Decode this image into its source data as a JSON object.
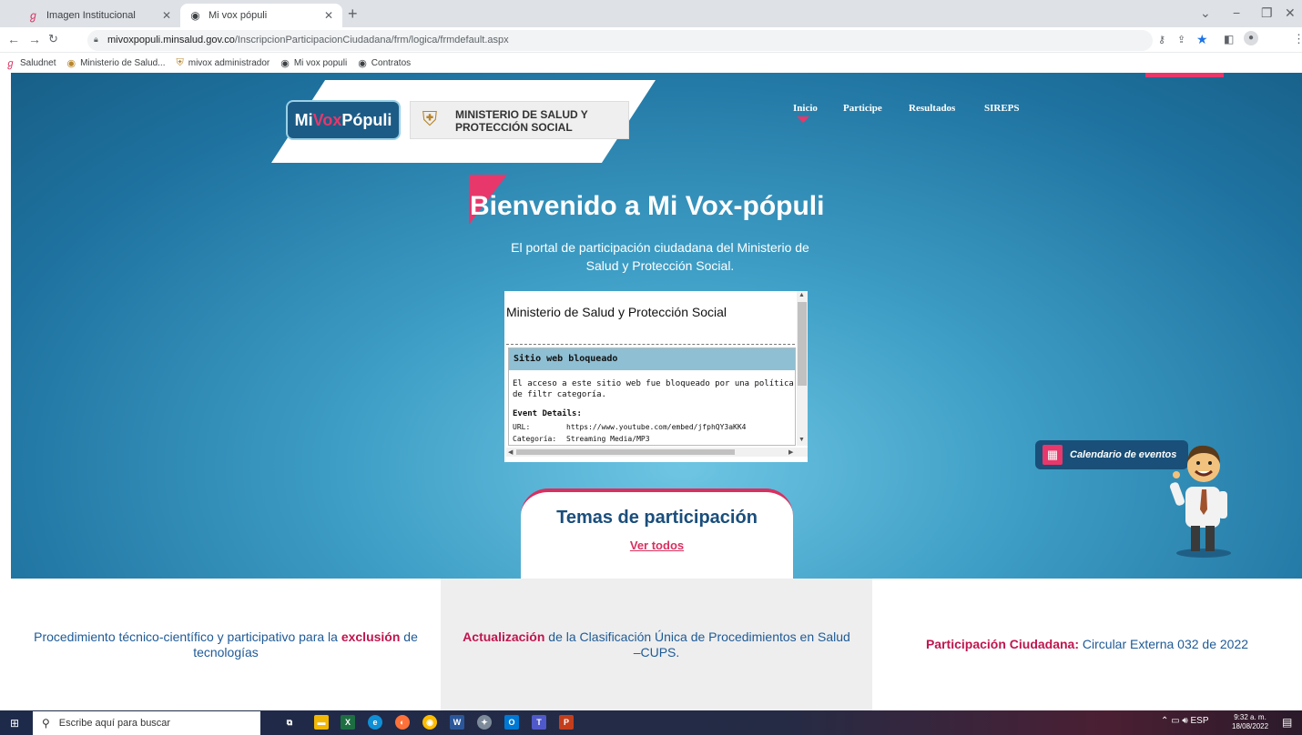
{
  "browser": {
    "tabs": [
      {
        "title": "Imagen Institucional",
        "icon": "saludnet-icon"
      },
      {
        "title": "Mi vox pópuli",
        "icon": "globe-icon"
      }
    ],
    "url_host": "mivoxpopuli.minsalud.gov.co",
    "url_path": "/InscripcionParticipacionCiudadana/frm/logica/frmdefault.aspx",
    "bookmarks": [
      "Saludnet",
      "Ministerio de Salud...",
      "mivox administrador",
      "Mi vox populi",
      "Contratos"
    ]
  },
  "header": {
    "logo_mi": "Mi",
    "logo_vox": "Vox",
    "logo_populi": "Pópuli",
    "ministry": "MINISTERIO DE SALUD Y PROTECCIÓN SOCIAL",
    "nav": [
      "Inicio",
      "Participe",
      "Resultados",
      "SIREPS"
    ]
  },
  "hero": {
    "title": "Bienvenido a Mi Vox-pópuli",
    "subtitle": "El portal de participación ciudadana del Ministerio de Salud y Protección Social."
  },
  "embed": {
    "org": "Ministerio de Salud y Protección Social",
    "blocked_title": "Sitio web bloqueado",
    "blocked_message": "El acceso a este sitio web fue bloqueado por una política de filtr categoría.",
    "event_details_label": "Event Details:",
    "url_label": "URL:",
    "url_value": "https://www.youtube.com/embed/jfphQY3aKK4",
    "category_label": "Categoría:",
    "category_value": "Streaming Media/MP3"
  },
  "temas": {
    "title": "Temas de participación",
    "link": "Ver todos"
  },
  "calendar": {
    "label": "Calendario de eventos"
  },
  "footer": {
    "col1_pre": "Procedimiento técnico-científico y participativo para la ",
    "col1_bold": "exclusión",
    "col1_post": " de tecnologías",
    "col2_bold": "Actualización",
    "col2_post": " de la Clasificación Única de Procedimientos en Salud –CUPS.",
    "col3_bold": "Participación Ciudadana:",
    "col3_post": " Circular Externa 032 de 2022"
  },
  "taskbar": {
    "search_placeholder": "Escribe aquí para buscar",
    "lang": "ESP",
    "time": "9:32 a. m.",
    "date": "18/08/2022"
  },
  "colors": {
    "accent": "#e8376a",
    "brand_blue": "#1a4e7c",
    "hero_blue": "#3f9fc6"
  }
}
